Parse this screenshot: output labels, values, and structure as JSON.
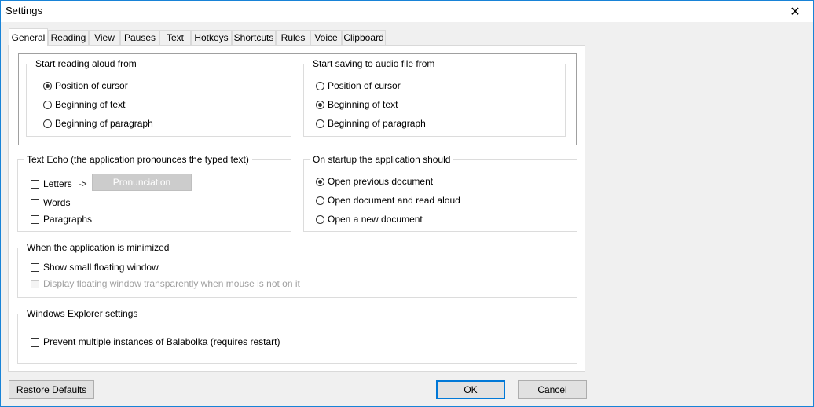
{
  "window": {
    "title": "Settings",
    "close_glyph": "✕"
  },
  "tabs": [
    {
      "label": "General",
      "active": true
    },
    {
      "label": "Reading"
    },
    {
      "label": "View"
    },
    {
      "label": "Pauses"
    },
    {
      "label": "Text"
    },
    {
      "label": "Hotkeys"
    },
    {
      "label": "Shortcuts"
    },
    {
      "label": "Rules"
    },
    {
      "label": "Voice"
    },
    {
      "label": "Clipboard"
    }
  ],
  "reading_start": {
    "title": "Start reading aloud from",
    "options": [
      {
        "label": "Position of cursor",
        "selected": true
      },
      {
        "label": "Beginning of text",
        "selected": false
      },
      {
        "label": "Beginning of paragraph",
        "selected": false
      }
    ]
  },
  "audio_start": {
    "title": "Start saving to audio file from",
    "options": [
      {
        "label": "Position of cursor",
        "selected": false
      },
      {
        "label": "Beginning of text",
        "selected": true
      },
      {
        "label": "Beginning of paragraph",
        "selected": false
      }
    ]
  },
  "text_echo": {
    "title": "Text Echo (the application pronounces the typed text)",
    "letters": "Letters",
    "arrow": "->",
    "pronunciation_button": "Pronunciation",
    "words": "Words",
    "paragraphs": "Paragraphs"
  },
  "startup": {
    "title": "On startup the application should",
    "options": [
      {
        "label": "Open previous document",
        "selected": true
      },
      {
        "label": "Open document and read aloud",
        "selected": false
      },
      {
        "label": "Open a new document",
        "selected": false
      }
    ]
  },
  "minimized": {
    "title": "When the application is minimized",
    "show_floating": "Show small floating window",
    "transparent": "Display floating window transparently when mouse is not on it"
  },
  "explorer": {
    "title": "Windows Explorer settings",
    "prevent_multiple": "Prevent multiple instances of Balabolka (requires restart)"
  },
  "buttons": {
    "restore": "Restore Defaults",
    "ok": "OK",
    "cancel": "Cancel"
  }
}
